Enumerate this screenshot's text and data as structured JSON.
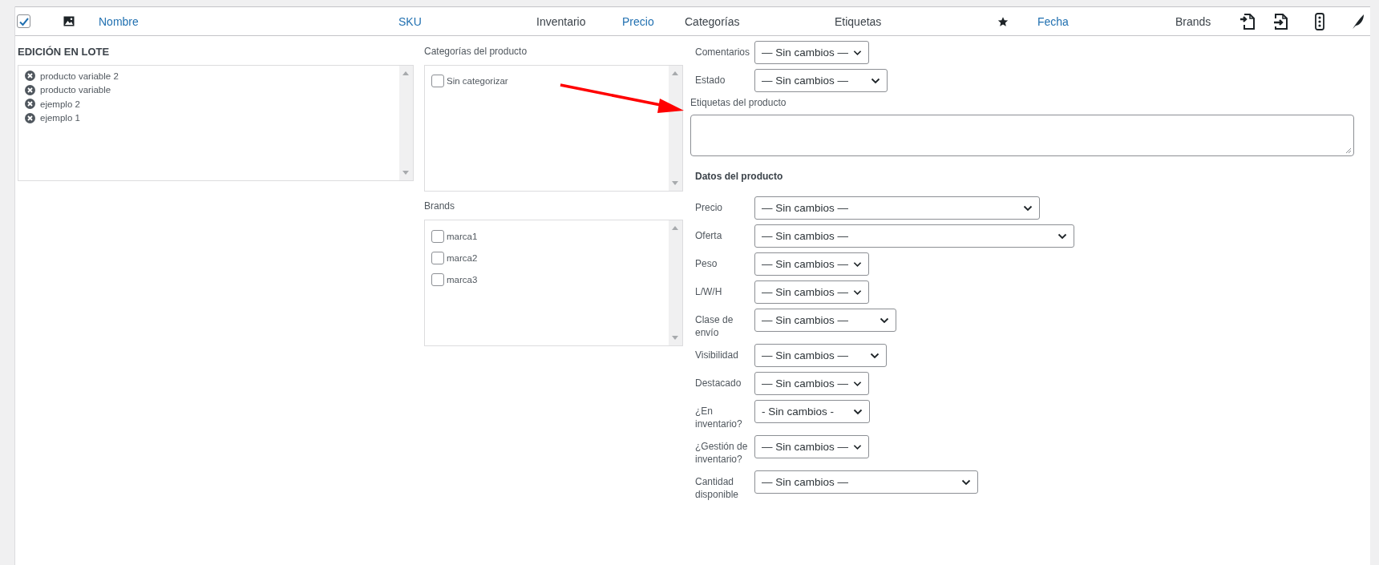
{
  "header": {
    "columns": [
      {
        "kind": "checkbox",
        "checked": true
      },
      {
        "kind": "image"
      },
      {
        "kind": "text",
        "label": "Nombre",
        "link": true
      },
      {
        "kind": "text",
        "label": "SKU",
        "link": true
      },
      {
        "kind": "text",
        "label": "Inventario",
        "link": false
      },
      {
        "kind": "text",
        "label": "Precio",
        "link": true
      },
      {
        "kind": "text",
        "label": "Categorías",
        "link": false
      },
      {
        "kind": "text",
        "label": "Etiquetas",
        "link": false
      },
      {
        "kind": "star"
      },
      {
        "kind": "text",
        "label": "Fecha",
        "link": true
      },
      {
        "kind": "text",
        "label": "Brands",
        "link": false
      },
      {
        "kind": "import"
      },
      {
        "kind": "export"
      },
      {
        "kind": "menu"
      },
      {
        "kind": "feather"
      }
    ]
  },
  "bulk_edit": {
    "title": "EDICIÓN EN LOTE",
    "items": [
      {
        "label": "producto variable 2"
      },
      {
        "label": "producto variable"
      },
      {
        "label": "ejemplo 2"
      },
      {
        "label": "ejemplo 1"
      }
    ]
  },
  "categories": {
    "label": "Categorías del producto",
    "options": [
      {
        "label": "Sin categorizar",
        "checked": false
      }
    ]
  },
  "brands": {
    "label": "Brands",
    "options": [
      {
        "label": "marca1",
        "checked": false
      },
      {
        "label": "marca2",
        "checked": false
      },
      {
        "label": "marca3",
        "checked": false
      }
    ]
  },
  "top_fields": [
    {
      "label": "Comentarios",
      "value": "— Sin cambios —"
    },
    {
      "label": "Estado",
      "value": "— Sin cambios —"
    }
  ],
  "tags": {
    "label": "Etiquetas del producto"
  },
  "product_data": {
    "title": "Datos del producto",
    "fields": [
      {
        "label": "Precio",
        "value": "— Sin cambios —"
      },
      {
        "label": "Oferta",
        "value": "— Sin cambios —"
      },
      {
        "label": "Peso",
        "value": "— Sin cambios —"
      },
      {
        "label": "L/W/H",
        "value": "— Sin cambios —"
      },
      {
        "label": "Clase de envío",
        "value": "— Sin cambios —"
      },
      {
        "label": "Visibilidad",
        "value": "— Sin cambios —"
      },
      {
        "label": "Destacado",
        "value": "— Sin cambios —"
      },
      {
        "label": "¿En inventario?",
        "value": "- Sin cambios -"
      },
      {
        "label": "¿Gestión de inventario?",
        "value": "— Sin cambios —"
      },
      {
        "label": "Cantidad disponible",
        "value": "— Sin cambios —"
      }
    ]
  }
}
